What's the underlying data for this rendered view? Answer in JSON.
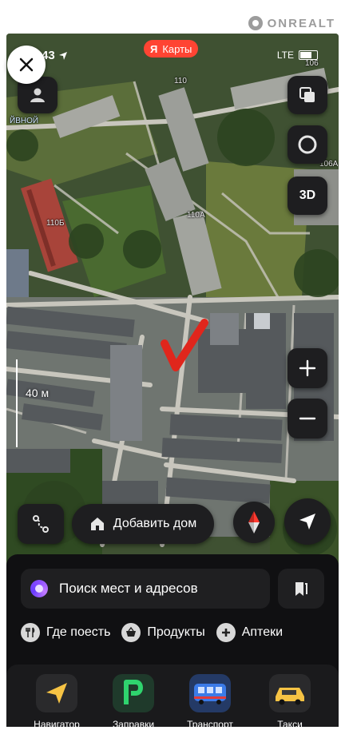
{
  "watermark": {
    "text": "ONREALT"
  },
  "status_bar": {
    "time": "43",
    "network": "LTE"
  },
  "app_badge": {
    "brand": "Я",
    "label": "Карты"
  },
  "map": {
    "labels": {
      "b110": "110",
      "b110a": "110А",
      "b110b": "110Б",
      "b106": "106",
      "b106a": "106А",
      "street": "ЙВНОЙ"
    },
    "mode_3d": "3D",
    "scale": "40 м"
  },
  "actions": {
    "add_home": "Добавить дом"
  },
  "search": {
    "placeholder": "Поиск мест и адресов"
  },
  "categories": [
    {
      "label": "Где поесть"
    },
    {
      "label": "Продукты"
    },
    {
      "label": "Аптеки"
    }
  ],
  "services": [
    {
      "label": "Навигатор"
    },
    {
      "label": "Заправки"
    },
    {
      "label": "Транспорт"
    },
    {
      "label": "Такси"
    }
  ],
  "colors": {
    "badge": "#ff4433",
    "marker": "#e0261c",
    "sheet": "#101012",
    "control": "#1e1e20"
  }
}
